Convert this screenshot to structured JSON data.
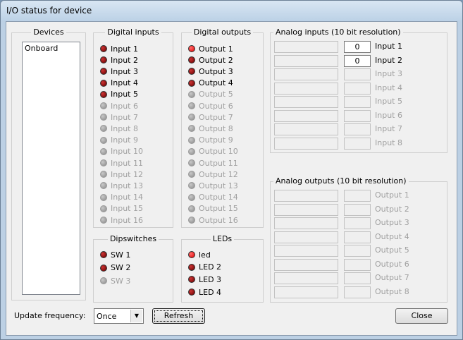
{
  "window": {
    "title": "I/O status for device"
  },
  "devices": {
    "title": "Devices",
    "items": [
      "Onboard"
    ]
  },
  "digital_inputs": {
    "title": "Digital inputs",
    "items": [
      {
        "label": "Input 1",
        "state": "off"
      },
      {
        "label": "Input 2",
        "state": "off"
      },
      {
        "label": "Input 3",
        "state": "off"
      },
      {
        "label": "Input 4",
        "state": "off"
      },
      {
        "label": "Input 5",
        "state": "off"
      },
      {
        "label": "Input 6",
        "state": "disabled"
      },
      {
        "label": "Input 7",
        "state": "disabled"
      },
      {
        "label": "Input 8",
        "state": "disabled"
      },
      {
        "label": "Input 9",
        "state": "disabled"
      },
      {
        "label": "Input 10",
        "state": "disabled"
      },
      {
        "label": "Input 11",
        "state": "disabled"
      },
      {
        "label": "Input 12",
        "state": "disabled"
      },
      {
        "label": "Input 13",
        "state": "disabled"
      },
      {
        "label": "Input 14",
        "state": "disabled"
      },
      {
        "label": "Input 15",
        "state": "disabled"
      },
      {
        "label": "Input 16",
        "state": "disabled"
      }
    ]
  },
  "digital_outputs": {
    "title": "Digital outputs",
    "items": [
      {
        "label": "Output 1",
        "state": "on"
      },
      {
        "label": "Output 2",
        "state": "off"
      },
      {
        "label": "Output 3",
        "state": "off"
      },
      {
        "label": "Output 4",
        "state": "off"
      },
      {
        "label": "Output 5",
        "state": "disabled"
      },
      {
        "label": "Output 6",
        "state": "disabled"
      },
      {
        "label": "Output 7",
        "state": "disabled"
      },
      {
        "label": "Output 8",
        "state": "disabled"
      },
      {
        "label": "Output 9",
        "state": "disabled"
      },
      {
        "label": "Output 10",
        "state": "disabled"
      },
      {
        "label": "Output 11",
        "state": "disabled"
      },
      {
        "label": "Output 12",
        "state": "disabled"
      },
      {
        "label": "Output 13",
        "state": "disabled"
      },
      {
        "label": "Output 14",
        "state": "disabled"
      },
      {
        "label": "Output 15",
        "state": "disabled"
      },
      {
        "label": "Output 16",
        "state": "disabled"
      }
    ]
  },
  "dipswitches": {
    "title": "Dipswitches",
    "items": [
      {
        "label": "SW 1",
        "state": "off"
      },
      {
        "label": "SW 2",
        "state": "off"
      },
      {
        "label": "SW 3",
        "state": "disabled"
      }
    ]
  },
  "leds": {
    "title": "LEDs",
    "items": [
      {
        "label": "led",
        "state": "on"
      },
      {
        "label": "LED 2",
        "state": "off"
      },
      {
        "label": "LED 3",
        "state": "off"
      },
      {
        "label": "LED 4",
        "state": "off"
      }
    ]
  },
  "analog_inputs": {
    "title": "Analog inputs (10 bit resolution)",
    "items": [
      {
        "label": "Input 1",
        "value": "0",
        "enabled": true
      },
      {
        "label": "Input 2",
        "value": "0",
        "enabled": true
      },
      {
        "label": "Input 3",
        "value": "",
        "enabled": false
      },
      {
        "label": "Input 4",
        "value": "",
        "enabled": false
      },
      {
        "label": "Input 5",
        "value": "",
        "enabled": false
      },
      {
        "label": "Input 6",
        "value": "",
        "enabled": false
      },
      {
        "label": "Input 7",
        "value": "",
        "enabled": false
      },
      {
        "label": "Input 8",
        "value": "",
        "enabled": false
      }
    ]
  },
  "analog_outputs": {
    "title": "Analog outputs (10 bit resolution)",
    "items": [
      {
        "label": "Output 1",
        "value": "",
        "enabled": false
      },
      {
        "label": "Output 2",
        "value": "",
        "enabled": false
      },
      {
        "label": "Output 3",
        "value": "",
        "enabled": false
      },
      {
        "label": "Output 4",
        "value": "",
        "enabled": false
      },
      {
        "label": "Output 5",
        "value": "",
        "enabled": false
      },
      {
        "label": "Output 6",
        "value": "",
        "enabled": false
      },
      {
        "label": "Output 7",
        "value": "",
        "enabled": false
      },
      {
        "label": "Output 8",
        "value": "",
        "enabled": false
      }
    ]
  },
  "footer": {
    "update_label": "Update frequency:",
    "update_value": "Once",
    "refresh_label": "Refresh",
    "close_label": "Close"
  },
  "colors": {
    "led_on": "#e00000",
    "led_off": "#800000",
    "disabled_text": "#a0a0a0"
  }
}
